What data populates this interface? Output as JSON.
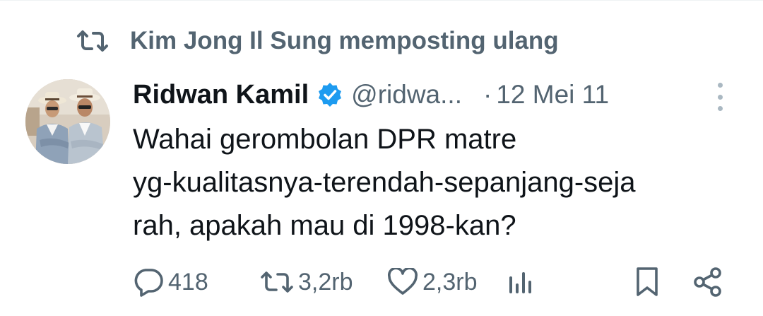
{
  "social_context": {
    "text": "Kim Jong Il Sung memposting ulang",
    "icon": "repost-icon"
  },
  "author": {
    "display_name": "Ridwan Kamil",
    "handle": "@ridwa...",
    "separator": "·",
    "date": "12 Mei 11",
    "verified_color": "#1d9bf0"
  },
  "tweet": {
    "lines": [
      "Wahai gerombolan DPR matre",
      "yg-kualitasnya-terendah-sepanjang-seja",
      "rah, apakah mau di 1998-kan?"
    ]
  },
  "actions": {
    "reply_count": "418",
    "repost_count": "3,2rb",
    "like_count": "2,3rb"
  },
  "colors": {
    "text_primary": "#0f1419",
    "text_secondary": "#536471",
    "accent": "#1d9bf0"
  }
}
